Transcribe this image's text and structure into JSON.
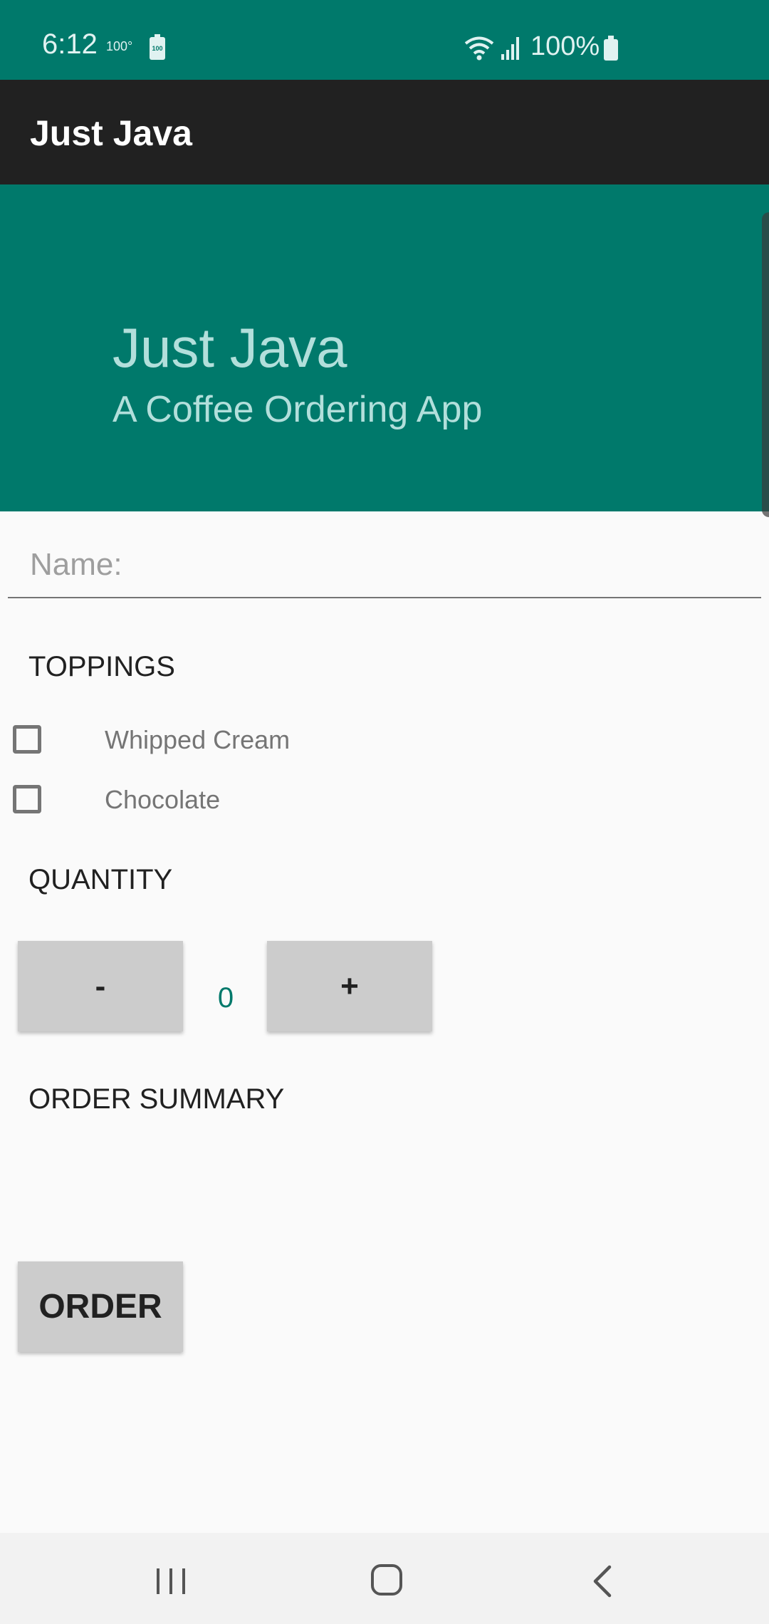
{
  "status_bar": {
    "time": "6:12",
    "temperature": "100°",
    "battery_small": "100",
    "battery_percent": "100%"
  },
  "app_bar": {
    "title": "Just Java"
  },
  "header": {
    "title": "Just Java",
    "subtitle": "A Coffee Ordering App"
  },
  "name_field": {
    "placeholder": "Name:",
    "value": ""
  },
  "toppings": {
    "label": "TOPPINGS",
    "items": [
      {
        "label": "Whipped Cream",
        "checked": false
      },
      {
        "label": "Chocolate",
        "checked": false
      }
    ]
  },
  "quantity": {
    "label": "QUANTITY",
    "decrement_label": "-",
    "increment_label": "+",
    "value": "0"
  },
  "order_summary": {
    "label": "ORDER SUMMARY"
  },
  "order_button": {
    "label": "ORDER"
  },
  "colors": {
    "primary": "#00796B",
    "app_bar": "#212121",
    "header_text": "#B2DFDB",
    "button": "#CCCCCC",
    "background": "#FAFAFA"
  },
  "nav_bar": {
    "icons": [
      "recent-apps-icon",
      "home-icon",
      "back-icon"
    ]
  }
}
